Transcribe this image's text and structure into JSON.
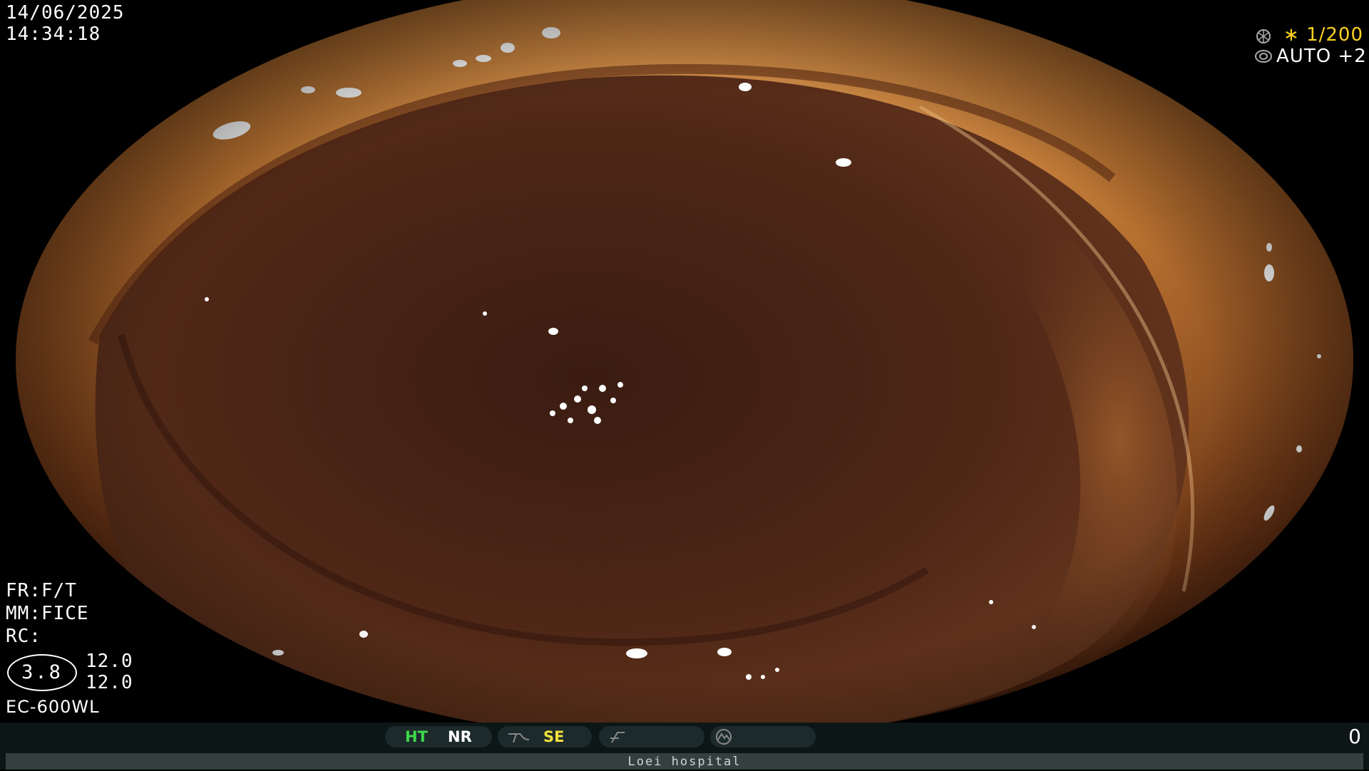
{
  "overlay": {
    "date": "14/06/2025",
    "time": "14:34:18",
    "shutter_label": "∗ 1/200",
    "iris_label": "AUTO +2",
    "fr": "FR:F/T",
    "mm": "MM:FICE",
    "rc": "RC:",
    "magnification": "3.8",
    "value_top": "12.0",
    "value_bottom": "12.0",
    "scope_model": "EC-600WL",
    "counter": "0"
  },
  "status_bar": {
    "ht": "HT",
    "nr": "NR",
    "se": "SE",
    "hospital": "Loei hospital"
  },
  "colors": {
    "shutter": "#ffd21f",
    "ht": "#3ed94a",
    "se": "#f2e23a",
    "tissue_light": "#c98a3c",
    "tissue_dark": "#3a1a0f"
  },
  "icons": [
    "shutter-icon",
    "iris-icon",
    "structure-icon",
    "enhance-icon",
    "color-mode-icon"
  ]
}
